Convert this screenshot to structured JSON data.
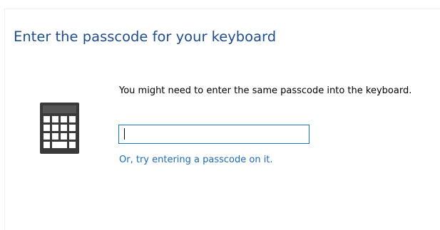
{
  "dialog": {
    "title": "Enter the passcode for your keyboard",
    "message": "You might need to enter the same passcode into the keyboard.",
    "passcode_input": {
      "value": "",
      "placeholder": ""
    },
    "alternate_link": "Or, try entering a passcode on it.",
    "icon": "keypad-icon"
  },
  "colors": {
    "title": "#1f4e8c",
    "link": "#1b6bb8",
    "input_border": "#1a73c0",
    "icon": "#3a3a3a"
  }
}
